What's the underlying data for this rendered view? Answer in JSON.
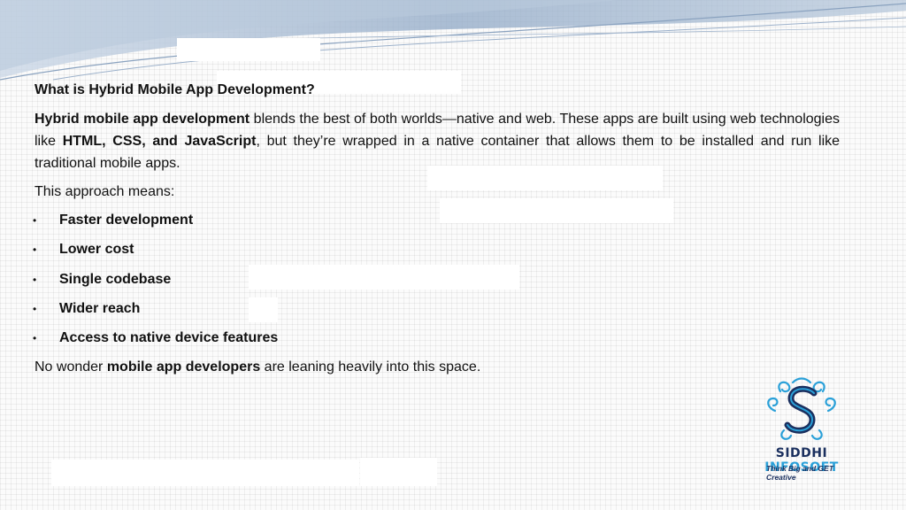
{
  "heading": "What is Hybrid Mobile App Development?",
  "paragraph": {
    "bold1": "Hybrid mobile app development",
    "text1": " blends the best of both worlds—native and web. These apps are built using web technologies like ",
    "bold2": "HTML, CSS, and JavaScript",
    "text2": ", but they’re wrapped in a native container that allows them to be installed and run like traditional mobile apps."
  },
  "intro": "This approach means:",
  "bullets": [
    {
      "label": "Faster development"
    },
    {
      "label": "Lower cost"
    },
    {
      "label": "Single codebase"
    },
    {
      "label": "Wider reach"
    },
    {
      "label": "Access to native device features"
    }
  ],
  "bullet_glyph": "•",
  "closing": {
    "pre": "No wonder ",
    "bold": "mobile app developers",
    "post": " are leaning heavily into this space."
  },
  "logo": {
    "icon": "ornate-s-logo-icon",
    "name_part1": "SIDDHI",
    "name_part2": "INFOSOFT",
    "tagline": "Think Big and GET Creative",
    "color_dark": "#1a2f5e",
    "color_light": "#2aa0d8"
  }
}
